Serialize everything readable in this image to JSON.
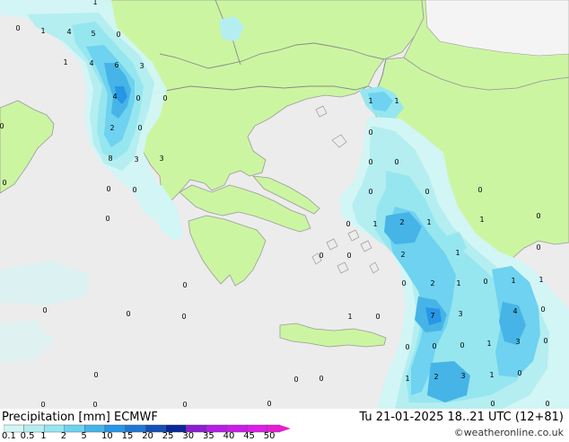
{
  "footer": {
    "title": "Precipitation [mm] ECMWF",
    "valid_time": "Tu 21-01-2025 18..21 UTC (12+81)",
    "credit": "©weatheronline.co.uk"
  },
  "legend": {
    "levels": [
      "0.1",
      "0.5",
      "1",
      "2",
      "5",
      "10",
      "15",
      "20",
      "25",
      "30",
      "35",
      "40",
      "45",
      "50"
    ],
    "colors": [
      "#d2f5f5",
      "#b4eef0",
      "#96e6f0",
      "#6ed2f0",
      "#46b4e6",
      "#2896e6",
      "#1e78d2",
      "#1450b4",
      "#0a2896",
      "#8c1ed2",
      "#b41ee6",
      "#c81ee6",
      "#dc1ee6",
      "#e61ed2"
    ]
  },
  "map_colors": {
    "sea": "#ececec",
    "land": "#ccf5a2",
    "coast": "#9a9a9a",
    "border": "#8a8a8a"
  },
  "precip_values": [
    {
      "label": "1"
    },
    {
      "label": "0"
    },
    {
      "label": "1"
    },
    {
      "label": "4"
    },
    {
      "label": "5"
    },
    {
      "label": "0"
    },
    {
      "label": "1"
    },
    {
      "label": "4"
    },
    {
      "label": "6"
    },
    {
      "label": "3"
    },
    {
      "label": "4"
    },
    {
      "label": "0"
    },
    {
      "label": "0"
    },
    {
      "label": "2"
    },
    {
      "label": "3"
    },
    {
      "label": "0"
    },
    {
      "label": "8"
    },
    {
      "label": "3"
    },
    {
      "label": "0"
    },
    {
      "label": "0"
    },
    {
      "label": "0"
    },
    {
      "label": "0"
    },
    {
      "label": "1"
    },
    {
      "label": "1"
    },
    {
      "label": "0"
    },
    {
      "label": "0"
    },
    {
      "label": "0"
    },
    {
      "label": "0"
    },
    {
      "label": "0"
    },
    {
      "label": "0"
    },
    {
      "label": "1"
    },
    {
      "label": "0"
    },
    {
      "label": "2"
    },
    {
      "label": "1"
    },
    {
      "label": "1"
    },
    {
      "label": "0"
    },
    {
      "label": "2"
    },
    {
      "label": "1"
    },
    {
      "label": "0"
    },
    {
      "label": "0"
    },
    {
      "label": "0"
    },
    {
      "label": "2"
    },
    {
      "label": "1"
    },
    {
      "label": "0"
    },
    {
      "label": "1"
    },
    {
      "label": "1"
    },
    {
      "label": "0"
    },
    {
      "label": "0"
    },
    {
      "label": "0"
    },
    {
      "label": "0"
    },
    {
      "label": "7"
    },
    {
      "label": "3"
    },
    {
      "label": "4"
    },
    {
      "label": "0"
    },
    {
      "label": "1"
    },
    {
      "label": "0"
    },
    {
      "label": "1"
    },
    {
      "label": "3"
    },
    {
      "label": "0"
    },
    {
      "label": "0"
    },
    {
      "label": "0"
    },
    {
      "label": "0"
    },
    {
      "label": "1"
    },
    {
      "label": "2"
    },
    {
      "label": "3"
    },
    {
      "label": "1"
    },
    {
      "label": "0"
    },
    {
      "label": "0"
    },
    {
      "label": "0"
    },
    {
      "label": "0"
    },
    {
      "label": "0"
    },
    {
      "label": "0"
    },
    {
      "label": "0"
    },
    {
      "label": "0"
    },
    {
      "label": "0"
    },
    {
      "label": "0"
    },
    {
      "label": "0"
    },
    {
      "label": "0"
    }
  ]
}
